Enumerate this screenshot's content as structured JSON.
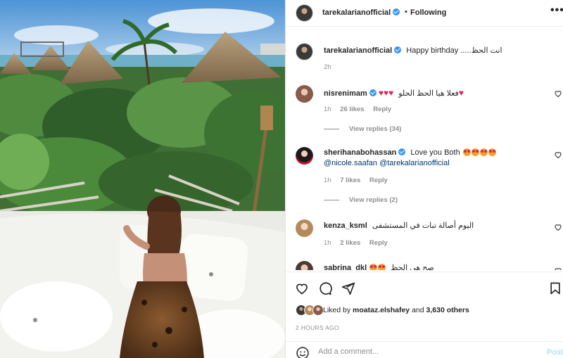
{
  "post": {
    "author": "tarekalarianofficial",
    "follow_dot": "•",
    "follow_label": "Following",
    "more_label": "•••",
    "caption_text": "Happy birthday .....انت الحظ",
    "caption_time": "2h"
  },
  "comments": [
    {
      "username": "nisrenimam",
      "text": "فعلا هيا الحظ الحلو",
      "time": "1h",
      "likes": "26 likes",
      "reply": "Reply",
      "view_replies": "View replies (34)"
    },
    {
      "username": "sherihanabohassan",
      "text": "Love you Both",
      "mention1": "@nicole.saafan",
      "mention2": "@tarekalarianofficial",
      "time": "1h",
      "likes": "7 likes",
      "reply": "Reply",
      "view_replies": "View replies (2)"
    },
    {
      "username": "kenza_ksml",
      "text": "اليوم أصالة تبات في المستشفى",
      "time": "1h",
      "likes": "2 likes",
      "reply": "Reply"
    },
    {
      "username": "sabrina_dkl",
      "text": "صح هي الحظ"
    }
  ],
  "likes": {
    "prefix": "Liked by",
    "user": "moataz.elshafey",
    "and": "and",
    "count": "3,630 others"
  },
  "time_ago": "2 HOURS AGO",
  "add_comment": {
    "placeholder": "Add a comment...",
    "post_label": "Post"
  },
  "colors": {
    "verified": "#3897f0",
    "mention": "#00376b",
    "muted": "#8e8e8e",
    "post_disabled": "#b2dffc"
  },
  "icons": [
    "verified-icon",
    "heart-icon",
    "comment-icon",
    "share-icon",
    "bookmark-icon",
    "emoji-icon",
    "more-icon"
  ]
}
